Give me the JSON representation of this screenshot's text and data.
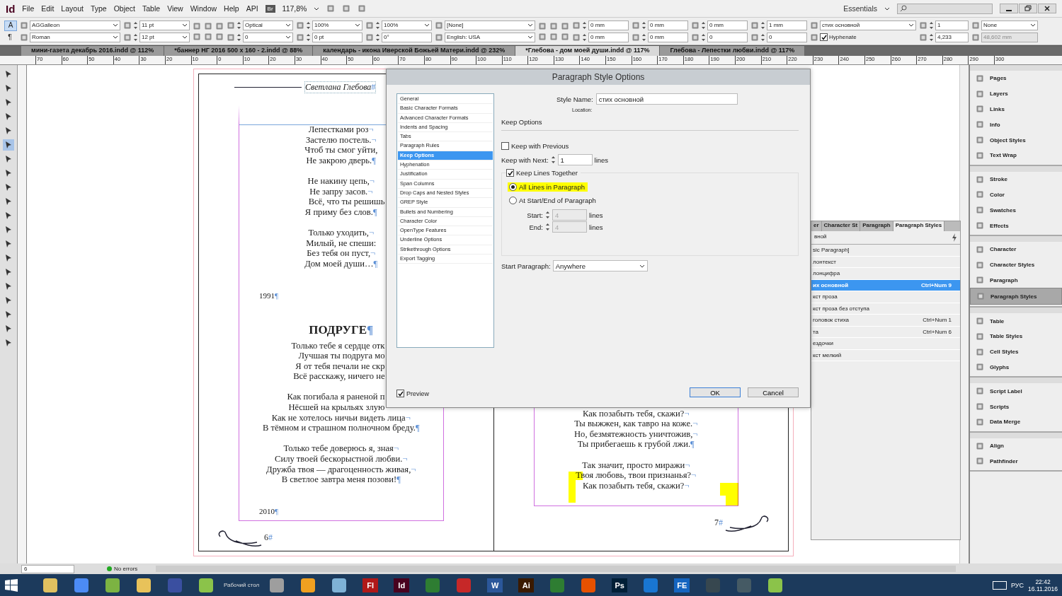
{
  "app": {
    "logo": "Id",
    "menus": [
      "File",
      "Edit",
      "Layout",
      "Type",
      "Object",
      "Table",
      "View",
      "Window",
      "Help",
      "API"
    ],
    "bridge": "Br",
    "zoom": "117,8%",
    "workspace": "Essentials"
  },
  "control_panel": [
    {
      "kind": "mode",
      "top": {
        "label": "A",
        "selected": true
      },
      "bottom": {
        "label": "¶",
        "selected": false
      }
    },
    {
      "kind": "fields",
      "top": {
        "kind": "dropdown",
        "value": "AGGalleon"
      },
      "bottom": {
        "kind": "dropdown",
        "value": "Roman"
      }
    },
    {
      "kind": "fields",
      "top": {
        "kind": "spindrop",
        "value": "11 pt"
      },
      "bottom": {
        "kind": "spindrop",
        "value": "12 pt"
      }
    },
    {
      "kind": "glyphs"
    },
    {
      "kind": "fields",
      "top": {
        "kind": "spindrop",
        "value": "Optical"
      },
      "bottom": {
        "kind": "spindrop",
        "value": "0"
      }
    },
    {
      "kind": "fields",
      "top": {
        "kind": "spindrop",
        "value": "100%"
      },
      "bottom": {
        "kind": "spin",
        "value": "0 pt"
      }
    },
    {
      "kind": "fields",
      "top": {
        "kind": "spindrop",
        "value": "100%"
      },
      "bottom": {
        "kind": "spin",
        "value": "0°"
      }
    },
    {
      "kind": "fields",
      "top": {
        "kind": "dropdown",
        "value": "[None]"
      },
      "bottom": {
        "kind": "dropdown",
        "value": "English: USA"
      }
    },
    {
      "kind": "glyphs"
    },
    {
      "kind": "fields",
      "top": {
        "kind": "spin",
        "value": "0 mm"
      },
      "bottom": {
        "kind": "spin",
        "value": "0 mm"
      }
    },
    {
      "kind": "fields",
      "top": {
        "kind": "spin",
        "value": "0 mm"
      },
      "bottom": {
        "kind": "spin",
        "value": "0 mm"
      }
    },
    {
      "kind": "fields",
      "top": {
        "kind": "spin",
        "value": "0 mm"
      },
      "bottom": {
        "kind": "spin",
        "value": "0"
      }
    },
    {
      "kind": "fields",
      "top": {
        "kind": "spin",
        "value": "1 mm"
      },
      "bottom": {
        "kind": "spin",
        "value": "0"
      }
    },
    {
      "kind": "fields",
      "top": {
        "kind": "dropdown",
        "value": "стих основной"
      },
      "bottom": {
        "kind": "check",
        "value": "Hyphenate",
        "checked": true
      }
    },
    {
      "kind": "fields",
      "top": {
        "kind": "spin",
        "value": "1"
      },
      "bottom": {
        "kind": "spin",
        "value": "4,233"
      }
    },
    {
      "kind": "fields",
      "top": {
        "kind": "dropdown",
        "value": "None"
      },
      "bottom": {
        "kind": "field",
        "value": "48,602 mm",
        "disabled": true
      }
    }
  ],
  "document_tabs": [
    {
      "label": "мини-газета декабрь 2016.indd @ 112%",
      "selected": false
    },
    {
      "label": "*баннер НГ 2016  500 x 160 - 2.indd @ 88%",
      "selected": false
    },
    {
      "label": "календарь - икона Иверской Божьей Матери.indd @ 232%",
      "selected": false
    },
    {
      "label": "*Глебова - дом моей души.indd @ 117%",
      "selected": true
    },
    {
      "label": "Глебова - Лепестки любви.indd @ 117%",
      "selected": false
    }
  ],
  "ruler": [
    "70",
    "60",
    "50",
    "40",
    "30",
    "20",
    "10",
    "0",
    "10",
    "20",
    "30",
    "40",
    "50",
    "60",
    "70",
    "80",
    "90",
    "100",
    "110",
    "120",
    "130",
    "140",
    "150",
    "160",
    "170",
    "180",
    "190",
    "200",
    "210",
    "220",
    "230",
    "240",
    "250",
    "260",
    "270",
    "280",
    "290",
    "300"
  ],
  "tools": [
    {
      "selected": false
    },
    {
      "selected": false
    },
    {
      "selected": false
    },
    {
      "selected": false
    },
    {
      "selected": false
    },
    {
      "selected": true
    },
    {
      "selected": false
    },
    {
      "selected": false
    },
    {
      "selected": false
    },
    {
      "selected": false
    },
    {
      "selected": false
    },
    {
      "selected": false
    },
    {
      "selected": false
    },
    {
      "selected": false
    },
    {
      "selected": false
    },
    {
      "selected": false
    },
    {
      "selected": false
    },
    {
      "selected": false
    },
    {
      "selected": false
    },
    {
      "selected": false
    }
  ],
  "left_page": {
    "header": "Светлана Глебова",
    "header_mark": "#",
    "blocks": [
      {
        "kind": "stanza",
        "lines": [
          {
            "text": "Лепестками роз",
            "mark": "¬"
          },
          {
            "text": "Застелю постель.",
            "mark": "¬"
          },
          {
            "text": "Чтоб ты смог уйти,"
          },
          {
            "text": "Не закрою дверь.",
            "mark": "¶"
          }
        ]
      },
      {
        "kind": "stanza",
        "lines": [
          {
            "text": "Не накину цепь,",
            "mark": "¬"
          },
          {
            "text": "Не запру засов.",
            "mark": "¬"
          },
          {
            "text": "Всё, что ты решишь",
            "cut": true
          },
          {
            "text": "Я приму без слов.",
            "mark": "¶"
          }
        ]
      },
      {
        "kind": "stanza",
        "lines": [
          {
            "text": "Только уходить,",
            "mark": "¬"
          },
          {
            "text": "Милый, не спеши:"
          },
          {
            "text": "Без тебя он пуст,",
            "mark": "¬"
          },
          {
            "text": "Дом моей души…",
            "mark": "¶"
          }
        ]
      },
      {
        "kind": "year",
        "lines": [
          {
            "text": "1991",
            "mark": "¶"
          }
        ]
      },
      {
        "kind": "title",
        "lines": [
          {
            "text": "ПОДРУГЕ",
            "mark": "¶"
          }
        ]
      },
      {
        "kind": "stanza",
        "lines": [
          {
            "text": "Только тебе я сердце отк",
            "cut": true
          },
          {
            "text": "Лучшая ты подруга мо",
            "cut": true
          },
          {
            "text": "Я от тебя печали не скр",
            "cut": true
          },
          {
            "text": "Всё расскажу, ничего не",
            "cut": true
          }
        ]
      },
      {
        "kind": "stanza",
        "lines": [
          {
            "text": "Как погибала я раненой п",
            "cut": true
          },
          {
            "text": "Нёсшей на крыльях злую",
            "cut": true
          },
          {
            "text": "Как не хотелось ничьи видеть лица",
            "mark": "¬"
          },
          {
            "text": "В тёмном и страшном полночном бреду.",
            "mark": "¶"
          }
        ]
      },
      {
        "kind": "stanza",
        "lines": [
          {
            "text": "Только тебе доверюсь я, зная",
            "mark": "¬"
          },
          {
            "text": "Силу твоей бескорыстной любви.",
            "mark": "¬"
          },
          {
            "text": "Дружба твоя — драгоценность живая,",
            "mark": "¬"
          },
          {
            "text": "В светлое завтра меня позови!",
            "mark": "¶"
          }
        ]
      },
      {
        "kind": "year",
        "lines": [
          {
            "text": "2010",
            "mark": "¶"
          }
        ]
      }
    ],
    "page_number": "6",
    "page_mark": "#"
  },
  "right_page": {
    "blocks": [
      {
        "kind": "stanza",
        "lines": [
          {
            "text": "Как позабыть тебя, скажи?",
            "mark": "¬"
          },
          {
            "text": "Ты выжжен, как тавро на коже.",
            "mark": "¬"
          },
          {
            "text": "Но, безмятежность уничтожив,",
            "mark": "¬"
          },
          {
            "text": "Ты прибегаешь к грубой лжи.",
            "mark": "¶"
          }
        ]
      },
      {
        "kind": "stanza",
        "lines": [
          {
            "text": "Так значит, просто миражи",
            "mark": "¬"
          },
          {
            "text": "Твоя любовь, твои признанья?",
            "mark": "¬"
          },
          {
            "text": "Как позабыть тебя, скажи?",
            "mark": "¬"
          }
        ]
      }
    ],
    "page_number": "7",
    "page_mark": "#"
  },
  "dialog": {
    "title": "Paragraph Style Options",
    "categories": [
      {
        "label": "General",
        "selected": false
      },
      {
        "label": "Basic Character Formats",
        "selected": false
      },
      {
        "label": "Advanced Character Formats",
        "selected": false
      },
      {
        "label": "Indents and Spacing",
        "selected": false
      },
      {
        "label": "Tabs",
        "selected": false
      },
      {
        "label": "Paragraph Rules",
        "selected": false
      },
      {
        "label": "Keep Options",
        "selected": true
      },
      {
        "label": "Hyphenation",
        "selected": false
      },
      {
        "label": "Justification",
        "selected": false
      },
      {
        "label": "Span Columns",
        "selected": false
      },
      {
        "label": "Drop Caps and Nested Styles",
        "selected": false
      },
      {
        "label": "GREP Style",
        "selected": false
      },
      {
        "label": "Bullets and Numbering",
        "selected": false
      },
      {
        "label": "Character Color",
        "selected": false
      },
      {
        "label": "OpenType Features",
        "selected": false
      },
      {
        "label": "Underline Options",
        "selected": false
      },
      {
        "label": "Strikethrough Options",
        "selected": false
      },
      {
        "label": "Export Tagging",
        "selected": false
      }
    ],
    "style_name_label": "Style Name:",
    "style_name": "стих основной",
    "location_label": "Location:",
    "section": "Keep Options",
    "keep_with_previous": {
      "label": "Keep with Previous",
      "checked": false
    },
    "keep_with_next": {
      "label": "Keep with Next:",
      "value": "1",
      "unit": "lines"
    },
    "keep_lines_together": {
      "label": "Keep Lines Together",
      "checked": true
    },
    "options": [
      {
        "label": "All Lines in Paragraph",
        "selected": true,
        "highlighted": true
      },
      {
        "label": "At Start/End of Paragraph",
        "selected": false,
        "highlighted": false
      }
    ],
    "start": {
      "label": "Start:",
      "value": "4",
      "unit": "lines",
      "disabled": true
    },
    "end": {
      "label": "End:",
      "value": "4",
      "unit": "lines",
      "disabled": true
    },
    "start_paragraph": {
      "label": "Start Paragraph:",
      "value": "Anywhere"
    },
    "preview": {
      "label": "Preview",
      "checked": true
    },
    "buttons": [
      {
        "label": "OK",
        "default": true
      },
      {
        "label": "Cancel",
        "default": false
      }
    ]
  },
  "styles_panel": {
    "tabs": [
      {
        "label": "er",
        "selected": false
      },
      {
        "label": "Character St",
        "selected": false
      },
      {
        "label": "Paragraph",
        "selected": false
      },
      {
        "label": "Paragraph Styles",
        "selected": true
      }
    ],
    "current": "вной",
    "rows": [
      {
        "name": "sic Paragraph]",
        "selected": false
      },
      {
        "name": "лонтекст",
        "selected": false
      },
      {
        "name": "лонцифра",
        "selected": false
      },
      {
        "name": "их основной",
        "shortcut": "Ctrl+Num 9",
        "selected": true
      },
      {
        "name": "кст проза",
        "selected": false
      },
      {
        "name": "кст проза без отступа",
        "selected": false
      },
      {
        "name": "головок стиха",
        "shortcut": "Ctrl+Num 1",
        "selected": false
      },
      {
        "name": "та",
        "shortcut": "Ctrl+Num 6",
        "selected": false
      },
      {
        "name": "ездочки",
        "selected": false
      },
      {
        "name": "кст мелкий",
        "selected": false
      }
    ]
  },
  "dock": [
    [
      {
        "label": "Pages",
        "selected": false
      },
      {
        "label": "Layers",
        "selected": false
      },
      {
        "label": "Links",
        "selected": false
      },
      {
        "label": "Info",
        "selected": false
      },
      {
        "label": "Object Styles",
        "selected": false
      },
      {
        "label": "Text Wrap",
        "selected": false
      }
    ],
    [
      {
        "label": "Stroke",
        "selected": false
      },
      {
        "label": "Color",
        "selected": false
      },
      {
        "label": "Swatches",
        "selected": false
      },
      {
        "label": "Effects",
        "selected": false
      }
    ],
    [
      {
        "label": "Character",
        "selected": false
      },
      {
        "label": "Character Styles",
        "selected": false
      },
      {
        "label": "Paragraph",
        "selected": false
      },
      {
        "label": "Paragraph Styles",
        "selected": true
      }
    ],
    [
      {
        "label": "Table",
        "selected": false
      },
      {
        "label": "Table Styles",
        "selected": false
      },
      {
        "label": "Cell Styles",
        "selected": false
      },
      {
        "label": "Glyphs",
        "selected": false
      }
    ],
    [
      {
        "label": "Script Label",
        "selected": false
      },
      {
        "label": "Scripts",
        "selected": false
      },
      {
        "label": "Data Merge",
        "selected": false
      }
    ],
    [
      {
        "label": "Align",
        "selected": false
      },
      {
        "label": "Pathfinder",
        "selected": false
      }
    ]
  ],
  "status_bar": {
    "page": "6",
    "preflight": "No errors"
  },
  "taskbar": {
    "items": [
      {
        "color": "#e0c060"
      },
      {
        "color": "#4c8bf5"
      },
      {
        "color": "#7cb342"
      },
      {
        "color": "#e8c25a"
      },
      {
        "color": "#3a4fa0"
      },
      {
        "color": "#8bc34a"
      },
      {
        "color": "#9e9e9e"
      },
      {
        "color": "#f0a020"
      },
      {
        "color": "#7fb2d6"
      },
      {
        "label": "Fl",
        "color": "#b01818"
      },
      {
        "label": "Id",
        "color": "#49021f"
      },
      {
        "color": "#2e7d32"
      },
      {
        "color": "#c62828"
      },
      {
        "label": "W",
        "color": "#2b579a"
      },
      {
        "label": "Ai",
        "color": "#3a1a00"
      },
      {
        "color": "#2e7d32"
      },
      {
        "color": "#e65100"
      },
      {
        "label": "Ps",
        "color": "#001e36"
      },
      {
        "color": "#1976d2"
      },
      {
        "label": "FE",
        "color": "#1565c0"
      },
      {
        "color": "#37474f"
      },
      {
        "color": "#455a64"
      },
      {
        "color": "#8bc34a"
      }
    ],
    "desktop_label": "Рабочий стол",
    "language": "РУС",
    "time": "22:42",
    "date": "16.11.2016"
  }
}
